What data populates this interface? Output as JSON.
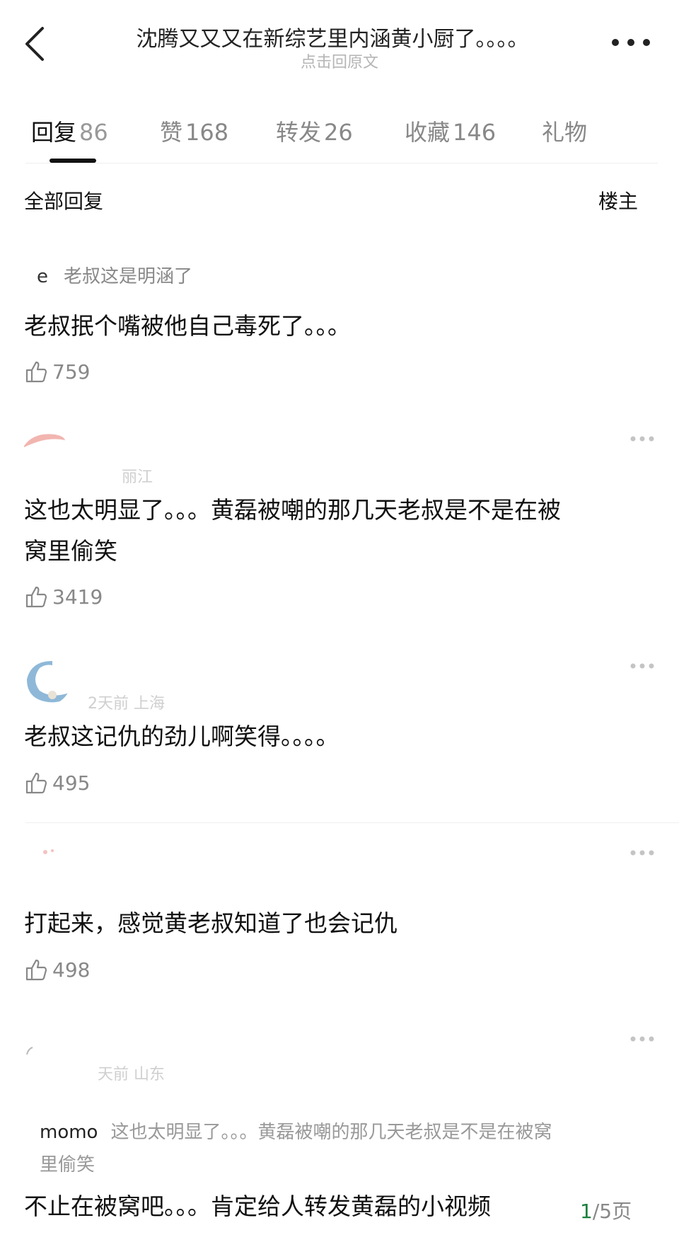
{
  "header": {
    "title": "沈腾又又又在新综艺里内涵黄小厨了。。。。",
    "subtitle": "点击回原文"
  },
  "tabs": [
    {
      "label": "回复",
      "count": "86"
    },
    {
      "label": "赞",
      "count": "168"
    },
    {
      "label": "转发",
      "count": "26"
    },
    {
      "label": "收藏",
      "count": "146"
    },
    {
      "label": "礼物",
      "count": ""
    }
  ],
  "section": {
    "left": "全部回复",
    "right": "楼主"
  },
  "comments": [
    {
      "reply_name": "e",
      "reply_text": "老叔这是明涵了",
      "text": "老叔抿个嘴被他自己毒死了。。。",
      "likes": "759"
    },
    {
      "meta": "丽江",
      "text_line1": "这也太明显了。。。黄磊被嘲的那几天老叔是不是在被",
      "text_line2": "窝里偷笑",
      "likes": "3419"
    },
    {
      "meta": "2天前 上海",
      "text": "老叔这记仇的劲儿啊笑得。。。。",
      "likes": "495"
    },
    {
      "meta": "",
      "text": "打起来，感觉黄老叔知道了也会记仇",
      "likes": "498"
    },
    {
      "meta": "天前 山东",
      "quote_user": "momo",
      "quote_line1": "这也太明显了。。。黄磊被嘲的那几天老叔是不是在被窝",
      "quote_line2": "里偷笑",
      "text": "不止在被窝吧。。。肯定给人转发黄磊的小视频"
    }
  ],
  "pager": {
    "current": "1",
    "total_text": "/5页"
  },
  "colors": {
    "accent_page": "#1b7f3e",
    "muted": "#888888"
  }
}
